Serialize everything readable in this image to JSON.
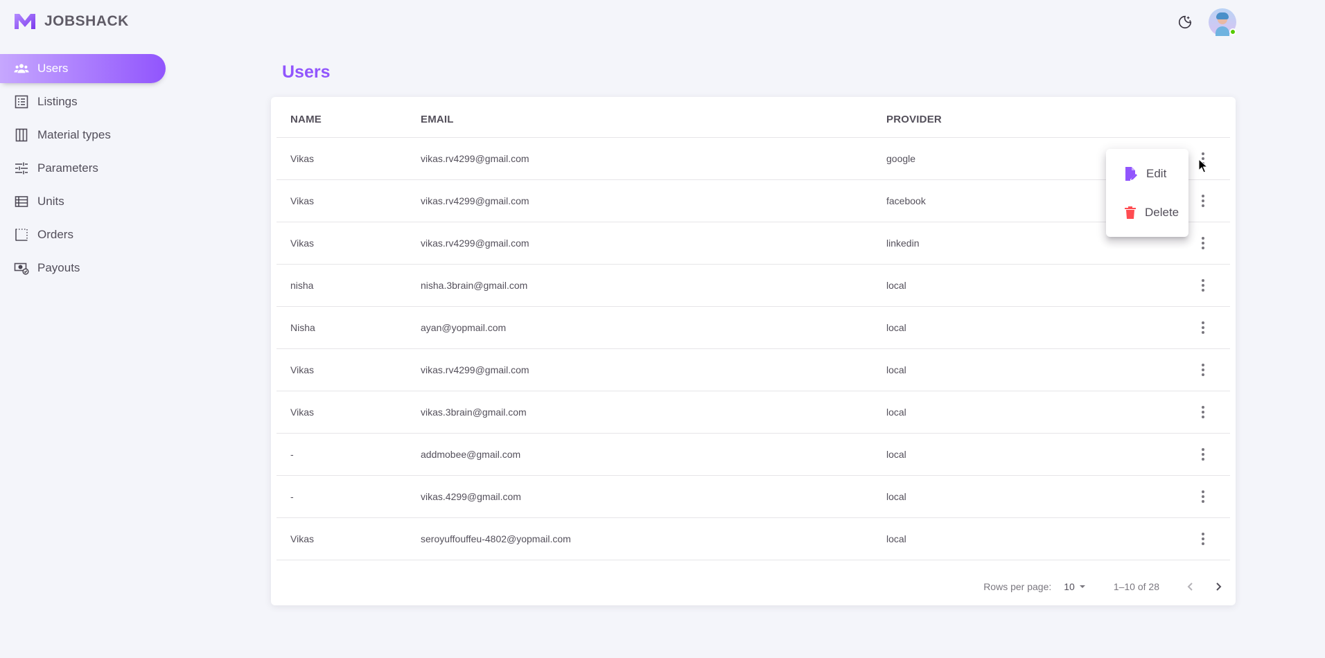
{
  "brand": {
    "name": "JOBSHACK",
    "accent": "#9155fd"
  },
  "sidebar": {
    "items": [
      {
        "label": "Users",
        "icon": "users-icon",
        "active": true
      },
      {
        "label": "Listings",
        "icon": "list-icon"
      },
      {
        "label": "Material types",
        "icon": "columns-icon"
      },
      {
        "label": "Parameters",
        "icon": "sliders-icon"
      },
      {
        "label": "Units",
        "icon": "table-icon"
      },
      {
        "label": "Orders",
        "icon": "dotted-square-icon"
      },
      {
        "label": "Payouts",
        "icon": "cash-icon"
      }
    ]
  },
  "header": {
    "theme_icon": "moon-star-icon",
    "avatar_status": "online"
  },
  "page": {
    "title": "Users"
  },
  "table": {
    "columns": [
      "NAME",
      "EMAIL",
      "PROVIDER"
    ],
    "rows": [
      {
        "name": "Vikas",
        "email": "vikas.rv4299@gmail.com",
        "provider": "google"
      },
      {
        "name": "Vikas",
        "email": "vikas.rv4299@gmail.com",
        "provider": "facebook"
      },
      {
        "name": "Vikas",
        "email": "vikas.rv4299@gmail.com",
        "provider": "linkedin"
      },
      {
        "name": "nisha",
        "email": "nisha.3brain@gmail.com",
        "provider": "local"
      },
      {
        "name": "Nisha",
        "email": "ayan@yopmail.com",
        "provider": "local"
      },
      {
        "name": "Vikas",
        "email": "vikas.rv4299@gmail.com",
        "provider": "local"
      },
      {
        "name": "Vikas",
        "email": "vikas.3brain@gmail.com",
        "provider": "local"
      },
      {
        "name": "-",
        "email": "addmobee@gmail.com",
        "provider": "local"
      },
      {
        "name": "-",
        "email": "vikas.4299@gmail.com",
        "provider": "local"
      },
      {
        "name": "Vikas",
        "email": "seroyuffouffeu-4802@yopmail.com",
        "provider": "local"
      }
    ]
  },
  "pagination": {
    "rows_per_page_label": "Rows per page:",
    "rows_per_page": "10",
    "range": "1–10 of 28"
  },
  "context_menu": {
    "edit_label": "Edit",
    "delete_label": "Delete",
    "edit_color": "#9155fd",
    "delete_color": "#ff4c51"
  }
}
